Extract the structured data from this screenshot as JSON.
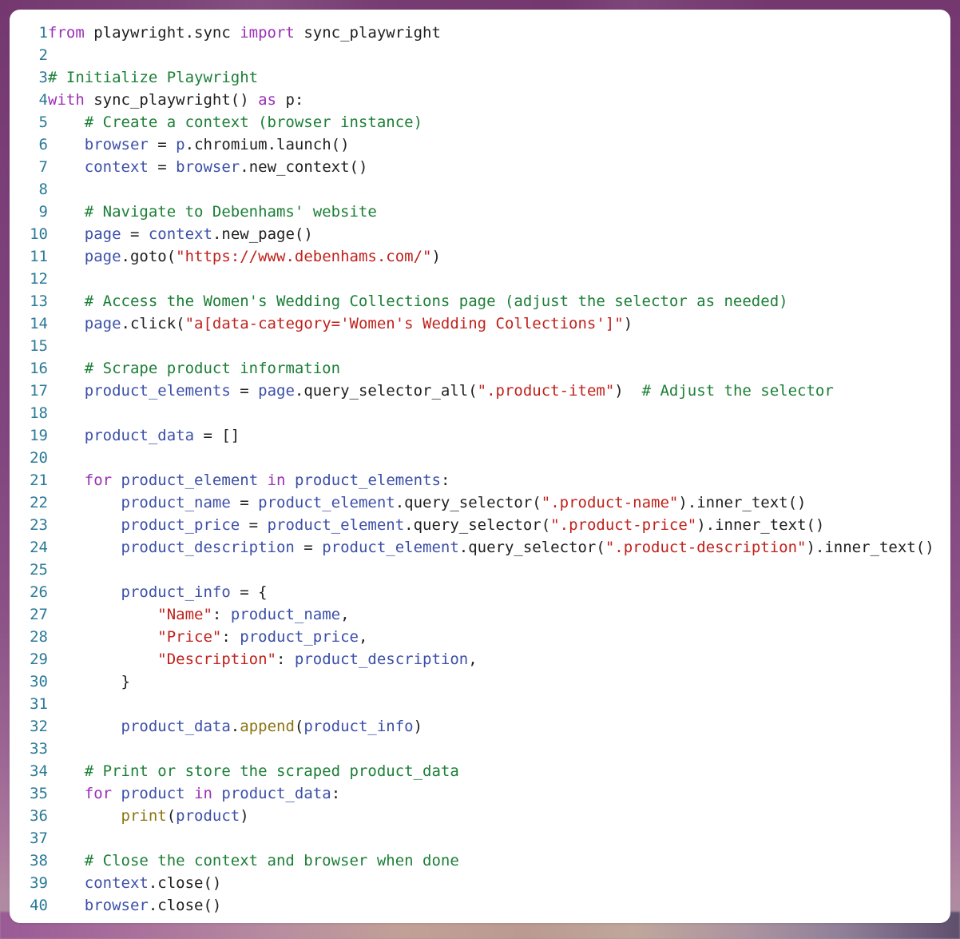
{
  "window": {
    "kind": "code-snippet-card",
    "language": "python",
    "background_color": "#7a3d77",
    "card_background": "#ffffff",
    "card_radius_px": 13
  },
  "theme": {
    "line_number_color": "#2b7a98",
    "keyword_color": "#9b30b5",
    "comment_color": "#1b7f36",
    "string_color": "#c0211c",
    "name_color": "#3b4fa8",
    "function_color": "#8a7410",
    "text_color": "#202020"
  },
  "code": {
    "first_line_number": 1,
    "last_line_number": 40,
    "line_numbers": [
      "1",
      "2",
      "3",
      "4",
      "5",
      "6",
      "7",
      "8",
      "9",
      "10",
      "11",
      "12",
      "13",
      "14",
      "15",
      "16",
      "17",
      "18",
      "19",
      "20",
      "21",
      "22",
      "23",
      "24",
      "25",
      "26",
      "27",
      "28",
      "29",
      "30",
      "31",
      "32",
      "33",
      "34",
      "35",
      "36",
      "37",
      "38",
      "39",
      "40"
    ],
    "lines": [
      {
        "n": "1",
        "text": "from playwright.sync import sync_playwright"
      },
      {
        "n": "2",
        "text": ""
      },
      {
        "n": "3",
        "text": "# Initialize Playwright"
      },
      {
        "n": "4",
        "text": "with sync_playwright() as p:"
      },
      {
        "n": "5",
        "text": "    # Create a context (browser instance)"
      },
      {
        "n": "6",
        "text": "    browser = p.chromium.launch()"
      },
      {
        "n": "7",
        "text": "    context = browser.new_context()"
      },
      {
        "n": "8",
        "text": ""
      },
      {
        "n": "9",
        "text": "    # Navigate to Debenhams' website"
      },
      {
        "n": "10",
        "text": "    page = context.new_page()"
      },
      {
        "n": "11",
        "text": "    page.goto(\"https://www.debenhams.com/\")"
      },
      {
        "n": "12",
        "text": ""
      },
      {
        "n": "13",
        "text": "    # Access the Women's Wedding Collections page (adjust the selector as needed)"
      },
      {
        "n": "14",
        "text": "    page.click(\"a[data-category='Women's Wedding Collections']\")"
      },
      {
        "n": "15",
        "text": ""
      },
      {
        "n": "16",
        "text": "    # Scrape product information"
      },
      {
        "n": "17",
        "text": "    product_elements = page.query_selector_all(\".product-item\")  # Adjust the selector"
      },
      {
        "n": "18",
        "text": ""
      },
      {
        "n": "19",
        "text": "    product_data = []"
      },
      {
        "n": "20",
        "text": ""
      },
      {
        "n": "21",
        "text": "    for product_element in product_elements:"
      },
      {
        "n": "22",
        "text": "        product_name = product_element.query_selector(\".product-name\").inner_text()"
      },
      {
        "n": "23",
        "text": "        product_price = product_element.query_selector(\".product-price\").inner_text()"
      },
      {
        "n": "24",
        "text": "        product_description = product_element.query_selector(\".product-description\").inner_text()"
      },
      {
        "n": "25",
        "text": ""
      },
      {
        "n": "26",
        "text": "        product_info = {"
      },
      {
        "n": "27",
        "text": "            \"Name\": product_name,"
      },
      {
        "n": "28",
        "text": "            \"Price\": product_price,"
      },
      {
        "n": "29",
        "text": "            \"Description\": product_description,"
      },
      {
        "n": "30",
        "text": "        }"
      },
      {
        "n": "31",
        "text": ""
      },
      {
        "n": "32",
        "text": "        product_data.append(product_info)"
      },
      {
        "n": "33",
        "text": ""
      },
      {
        "n": "34",
        "text": "    # Print or store the scraped product_data"
      },
      {
        "n": "35",
        "text": "    for product in product_data:"
      },
      {
        "n": "36",
        "text": "        print(product)"
      },
      {
        "n": "37",
        "text": ""
      },
      {
        "n": "38",
        "text": "    # Close the context and browser when done"
      },
      {
        "n": "39",
        "text": "    context.close()"
      },
      {
        "n": "40",
        "text": "    browser.close()"
      }
    ],
    "tokens": [
      [
        {
          "t": "from",
          "c": "k"
        },
        {
          "t": " playwright.sync ",
          "c": "p"
        },
        {
          "t": "import",
          "c": "k"
        },
        {
          "t": " sync_playwright",
          "c": "p"
        }
      ],
      [],
      [
        {
          "t": "# Initialize Playwright",
          "c": "c"
        }
      ],
      [
        {
          "t": "with",
          "c": "k"
        },
        {
          "t": " sync_playwright() ",
          "c": "p"
        },
        {
          "t": "as",
          "c": "k"
        },
        {
          "t": " p:",
          "c": "p"
        }
      ],
      [
        {
          "t": "    ",
          "c": "p"
        },
        {
          "t": "# Create a context (browser instance)",
          "c": "c"
        }
      ],
      [
        {
          "t": "    ",
          "c": "p"
        },
        {
          "t": "browser",
          "c": "n"
        },
        {
          "t": " = ",
          "c": "p"
        },
        {
          "t": "p",
          "c": "n"
        },
        {
          "t": ".chromium.launch()",
          "c": "p"
        }
      ],
      [
        {
          "t": "    ",
          "c": "p"
        },
        {
          "t": "context",
          "c": "n"
        },
        {
          "t": " = ",
          "c": "p"
        },
        {
          "t": "browser",
          "c": "n"
        },
        {
          "t": ".new_context()",
          "c": "p"
        }
      ],
      [],
      [
        {
          "t": "    ",
          "c": "p"
        },
        {
          "t": "# Navigate to Debenhams' website",
          "c": "c"
        }
      ],
      [
        {
          "t": "    ",
          "c": "p"
        },
        {
          "t": "page",
          "c": "n"
        },
        {
          "t": " = ",
          "c": "p"
        },
        {
          "t": "context",
          "c": "n"
        },
        {
          "t": ".new_page()",
          "c": "p"
        }
      ],
      [
        {
          "t": "    ",
          "c": "p"
        },
        {
          "t": "page",
          "c": "n"
        },
        {
          "t": ".goto(",
          "c": "p"
        },
        {
          "t": "\"https://www.debenhams.com/\"",
          "c": "s"
        },
        {
          "t": ")",
          "c": "p"
        }
      ],
      [],
      [
        {
          "t": "    ",
          "c": "p"
        },
        {
          "t": "# Access the Women's Wedding Collections page (adjust the selector as needed)",
          "c": "c"
        }
      ],
      [
        {
          "t": "    ",
          "c": "p"
        },
        {
          "t": "page",
          "c": "n"
        },
        {
          "t": ".click(",
          "c": "p"
        },
        {
          "t": "\"a[data-category='Women's Wedding Collections']\"",
          "c": "s"
        },
        {
          "t": ")",
          "c": "p"
        }
      ],
      [],
      [
        {
          "t": "    ",
          "c": "p"
        },
        {
          "t": "# Scrape product information",
          "c": "c"
        }
      ],
      [
        {
          "t": "    ",
          "c": "p"
        },
        {
          "t": "product_elements",
          "c": "n"
        },
        {
          "t": " = ",
          "c": "p"
        },
        {
          "t": "page",
          "c": "n"
        },
        {
          "t": ".query_selector_all(",
          "c": "p"
        },
        {
          "t": "\".product-item\"",
          "c": "s"
        },
        {
          "t": ")  ",
          "c": "p"
        },
        {
          "t": "# Adjust the selector",
          "c": "c"
        }
      ],
      [],
      [
        {
          "t": "    ",
          "c": "p"
        },
        {
          "t": "product_data",
          "c": "n"
        },
        {
          "t": " = []",
          "c": "p"
        }
      ],
      [],
      [
        {
          "t": "    ",
          "c": "p"
        },
        {
          "t": "for",
          "c": "k"
        },
        {
          "t": " ",
          "c": "p"
        },
        {
          "t": "product_element",
          "c": "n"
        },
        {
          "t": " ",
          "c": "p"
        },
        {
          "t": "in",
          "c": "k"
        },
        {
          "t": " ",
          "c": "p"
        },
        {
          "t": "product_elements",
          "c": "n"
        },
        {
          "t": ":",
          "c": "p"
        }
      ],
      [
        {
          "t": "        ",
          "c": "p"
        },
        {
          "t": "product_name",
          "c": "n"
        },
        {
          "t": " = ",
          "c": "p"
        },
        {
          "t": "product_element",
          "c": "n"
        },
        {
          "t": ".query_selector(",
          "c": "p"
        },
        {
          "t": "\".product-name\"",
          "c": "s"
        },
        {
          "t": ").inner_text()",
          "c": "p"
        }
      ],
      [
        {
          "t": "        ",
          "c": "p"
        },
        {
          "t": "product_price",
          "c": "n"
        },
        {
          "t": " = ",
          "c": "p"
        },
        {
          "t": "product_element",
          "c": "n"
        },
        {
          "t": ".query_selector(",
          "c": "p"
        },
        {
          "t": "\".product-price\"",
          "c": "s"
        },
        {
          "t": ").inner_text()",
          "c": "p"
        }
      ],
      [
        {
          "t": "        ",
          "c": "p"
        },
        {
          "t": "product_description",
          "c": "n"
        },
        {
          "t": " = ",
          "c": "p"
        },
        {
          "t": "product_element",
          "c": "n"
        },
        {
          "t": ".query_selector(",
          "c": "p"
        },
        {
          "t": "\".product-description\"",
          "c": "s"
        },
        {
          "t": ").inner_text()",
          "c": "p"
        }
      ],
      [],
      [
        {
          "t": "        ",
          "c": "p"
        },
        {
          "t": "product_info",
          "c": "n"
        },
        {
          "t": " = {",
          "c": "p"
        }
      ],
      [
        {
          "t": "            ",
          "c": "p"
        },
        {
          "t": "\"Name\"",
          "c": "s"
        },
        {
          "t": ": ",
          "c": "p"
        },
        {
          "t": "product_name",
          "c": "n"
        },
        {
          "t": ",",
          "c": "p"
        }
      ],
      [
        {
          "t": "            ",
          "c": "p"
        },
        {
          "t": "\"Price\"",
          "c": "s"
        },
        {
          "t": ": ",
          "c": "p"
        },
        {
          "t": "product_price",
          "c": "n"
        },
        {
          "t": ",",
          "c": "p"
        }
      ],
      [
        {
          "t": "            ",
          "c": "p"
        },
        {
          "t": "\"Description\"",
          "c": "s"
        },
        {
          "t": ": ",
          "c": "p"
        },
        {
          "t": "product_description",
          "c": "n"
        },
        {
          "t": ",",
          "c": "p"
        }
      ],
      [
        {
          "t": "        }",
          "c": "p"
        }
      ],
      [],
      [
        {
          "t": "        ",
          "c": "p"
        },
        {
          "t": "product_data",
          "c": "n"
        },
        {
          "t": ".",
          "c": "p"
        },
        {
          "t": "append",
          "c": "f"
        },
        {
          "t": "(",
          "c": "p"
        },
        {
          "t": "product_info",
          "c": "n"
        },
        {
          "t": ")",
          "c": "p"
        }
      ],
      [],
      [
        {
          "t": "    ",
          "c": "p"
        },
        {
          "t": "# Print or store the scraped product_data",
          "c": "c"
        }
      ],
      [
        {
          "t": "    ",
          "c": "p"
        },
        {
          "t": "for",
          "c": "k"
        },
        {
          "t": " ",
          "c": "p"
        },
        {
          "t": "product",
          "c": "n"
        },
        {
          "t": " ",
          "c": "p"
        },
        {
          "t": "in",
          "c": "k"
        },
        {
          "t": " ",
          "c": "p"
        },
        {
          "t": "product_data",
          "c": "n"
        },
        {
          "t": ":",
          "c": "p"
        }
      ],
      [
        {
          "t": "        ",
          "c": "p"
        },
        {
          "t": "print",
          "c": "f"
        },
        {
          "t": "(",
          "c": "p"
        },
        {
          "t": "product",
          "c": "n"
        },
        {
          "t": ")",
          "c": "p"
        }
      ],
      [],
      [
        {
          "t": "    ",
          "c": "p"
        },
        {
          "t": "# Close the context and browser when done",
          "c": "c"
        }
      ],
      [
        {
          "t": "    ",
          "c": "p"
        },
        {
          "t": "context",
          "c": "n"
        },
        {
          "t": ".close()",
          "c": "p"
        }
      ],
      [
        {
          "t": "    ",
          "c": "p"
        },
        {
          "t": "browser",
          "c": "n"
        },
        {
          "t": ".close()",
          "c": "p"
        }
      ]
    ]
  }
}
